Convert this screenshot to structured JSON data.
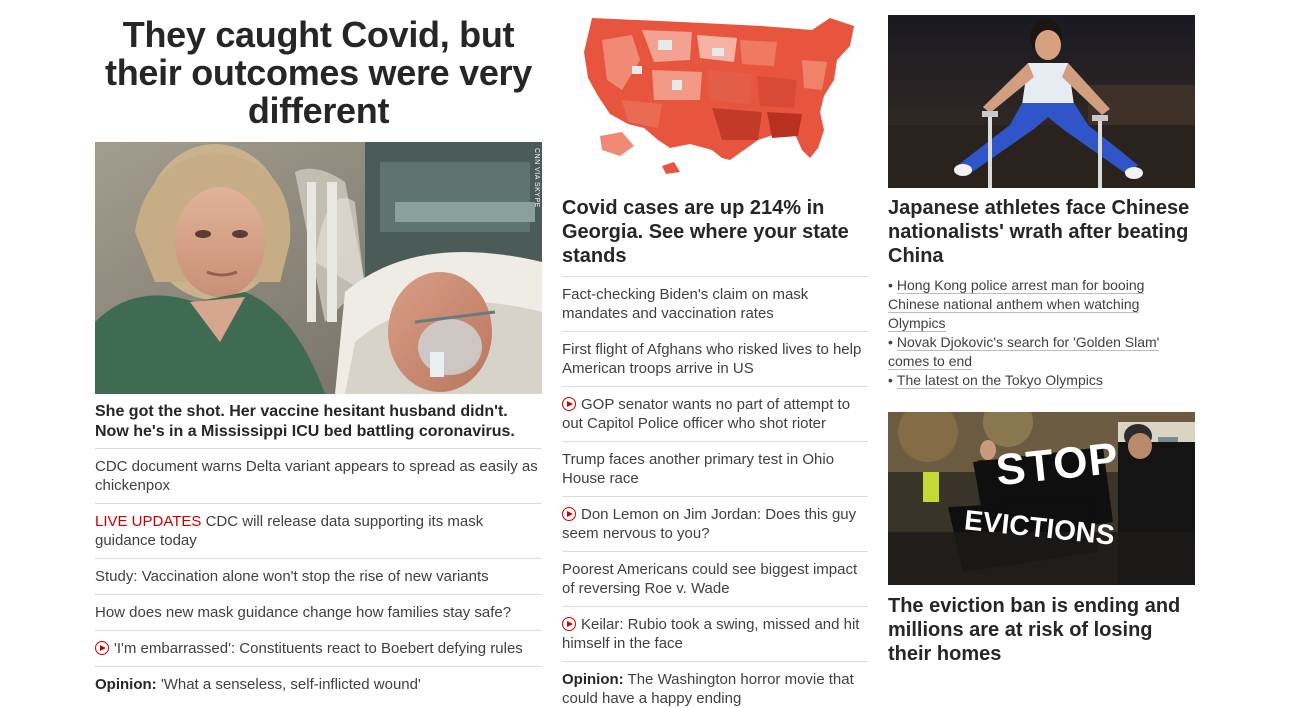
{
  "left": {
    "headline": "They caught Covid, but their outcomes were very different",
    "photo_credit": "CNN VIA SKYPE",
    "lead_title": "She got the shot. Her vaccine hesitant husband didn't. Now he's in a Mississippi ICU bed battling coronavirus.",
    "stories": [
      {
        "text": "CDC document warns Delta variant appears to spread as easily as chickenpox"
      },
      {
        "prefix": "LIVE UPDATES",
        "text": " CDC will release data supporting its mask guidance today"
      },
      {
        "text": "Study: Vaccination alone won't stop the rise of new variants"
      },
      {
        "text": "How does new mask guidance change how families stay safe?"
      },
      {
        "video": true,
        "text": "'I'm embarrassed': Constituents react to Boebert defying rules"
      },
      {
        "opinion": "Opinion:",
        "text": " 'What a senseless, self-inflicted wound'"
      }
    ]
  },
  "middle": {
    "lead_title": "Covid cases are up 214% in Georgia. See where your state stands",
    "stories": [
      {
        "text": "Fact-checking Biden's claim on mask mandates and vaccination rates"
      },
      {
        "text": "First flight of Afghans who risked lives to help American troops arrive in US"
      },
      {
        "video": true,
        "text": "GOP senator wants no part of attempt to out Capitol Police officer who shot rioter"
      },
      {
        "text": "Trump faces another primary test in Ohio House race"
      },
      {
        "video": true,
        "text": "Don Lemon on Jim Jordan: Does this guy seem nervous to you?"
      },
      {
        "text": "Poorest Americans could see biggest impact of reversing Roe v. Wade"
      },
      {
        "video": true,
        "text": "Keilar: Rubio took a swing, missed and hit himself in the face"
      },
      {
        "opinion": "Opinion:",
        "text": " The Washington horror movie that could have a happy ending"
      }
    ]
  },
  "right": {
    "top_title": "Japanese athletes face Chinese nationalists' wrath after beating China",
    "bullets": [
      "Hong Kong police arrest man for booing Chinese national anthem when watching Olympics",
      "Novak Djokovic's search for 'Golden Slam' comes to end",
      "The latest on the Tokyo Olympics"
    ],
    "sign_line1": "STOP",
    "sign_line2": "EVICTIONS",
    "bottom_title": "The eviction ban is ending and millions are at risk of losing their homes"
  },
  "colors": {
    "text": "#262626",
    "secondary": "#404040",
    "live_red": "#cc0000",
    "divider": "#dcdcdc",
    "map_base": "#e8553f"
  }
}
